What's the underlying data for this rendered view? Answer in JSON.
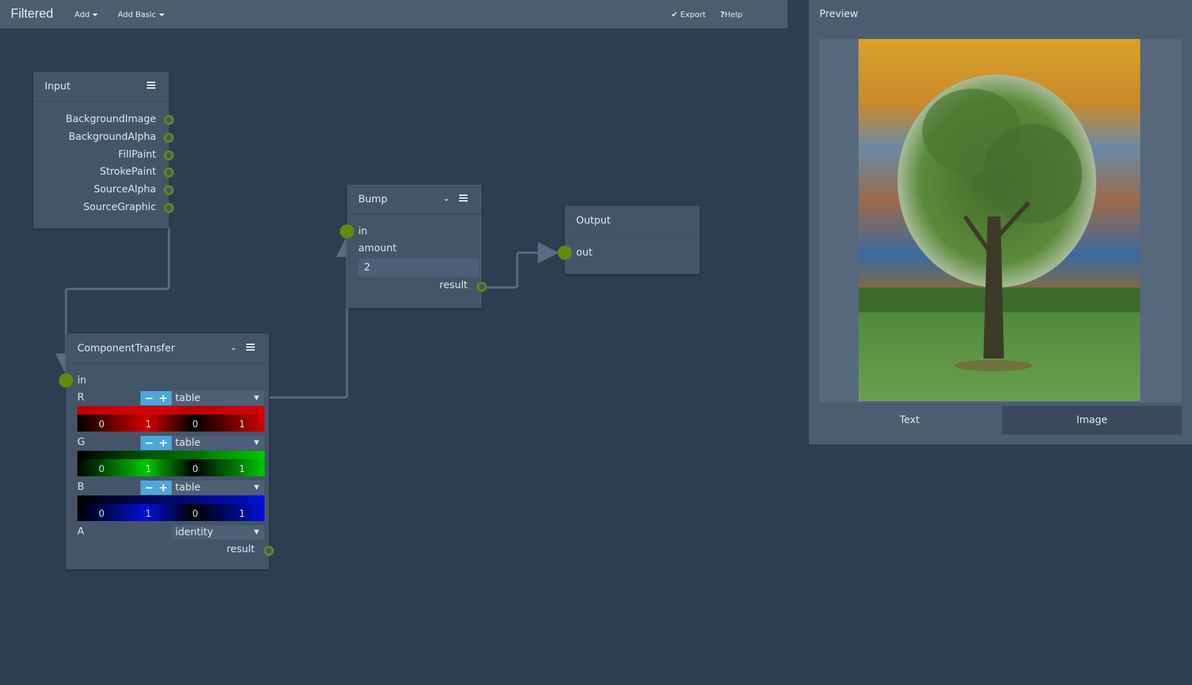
{
  "topbar": {
    "brand": "Filtered",
    "add_label": "Add",
    "add_basic_label": "Add Basic",
    "export_label": "Export",
    "help_label": "Help"
  },
  "nodes": {
    "input": {
      "title": "Input",
      "outputs": [
        "BackgroundImage",
        "BackgroundAlpha",
        "FillPaint",
        "StrokePaint",
        "SourceAlpha",
        "SourceGraphic"
      ]
    },
    "bump": {
      "title": "Bump",
      "in_label": "in",
      "amount_label": "amount",
      "amount_value": "2",
      "result_label": "result"
    },
    "output": {
      "title": "Output",
      "out_label": "out"
    },
    "component_transfer": {
      "title": "ComponentTransfer",
      "in_label": "in",
      "channels": [
        {
          "name": "R",
          "func": "table",
          "values": [
            "0",
            "1",
            "0",
            "1"
          ],
          "color": "#d40000"
        },
        {
          "name": "G",
          "func": "table",
          "values": [
            "0",
            "1",
            "0",
            "1"
          ],
          "color": "#00c800"
        },
        {
          "name": "B",
          "func": "table",
          "values": [
            "0",
            "1",
            "0",
            "1"
          ],
          "color": "#0010d8"
        }
      ],
      "alpha": {
        "name": "A",
        "func": "identity"
      },
      "result_label": "result"
    }
  },
  "preview": {
    "title": "Preview",
    "tabs": [
      {
        "label": "Text",
        "active": false
      },
      {
        "label": "Image",
        "active": true
      }
    ]
  },
  "colors": {
    "port": "#5e8c0f",
    "accent": "#4da7d6",
    "background": "#2c3e50",
    "panel": "#44556a"
  }
}
